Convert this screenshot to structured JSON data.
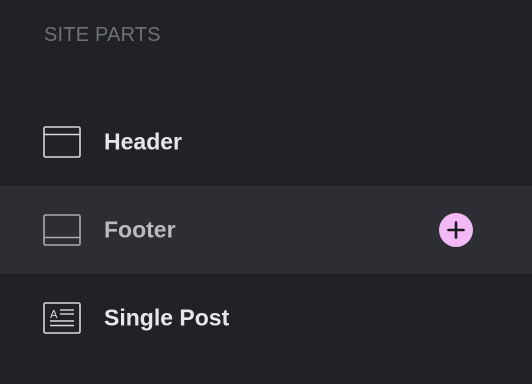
{
  "section": {
    "title": "SITE PARTS"
  },
  "items": [
    {
      "label": "Header",
      "icon": "header-layout-icon",
      "active": false
    },
    {
      "label": "Footer",
      "icon": "footer-layout-icon",
      "active": true,
      "action_icon": "plus-icon"
    },
    {
      "label": "Single Post",
      "icon": "single-post-icon",
      "active": false
    }
  ],
  "colors": {
    "background": "#212225",
    "active_row": "#2d2e33",
    "add_button": "#f3b9f6"
  }
}
